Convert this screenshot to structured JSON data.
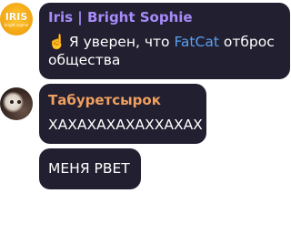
{
  "messages": [
    {
      "sender": "Iris | Bright Sophie",
      "emoji": "☝️",
      "text_before": " Я уверен, что ",
      "link": "FatCat",
      "text_after": " отброс общества",
      "avatar": {
        "icon": "iris-logo-avatar",
        "logo_text": "IRIS",
        "logo_sub": "bright sophie"
      }
    },
    {
      "sender": "Табуретсырок",
      "text": "ХАХАХАХАХАХХАХАХ",
      "avatar": {
        "icon": "cat-photo-avatar"
      }
    },
    {
      "text": "МЕНЯ РВЕТ"
    }
  ],
  "colors": {
    "bubble": "#221f30",
    "name_iris": "#a78bfa",
    "name_tab": "#f0a060",
    "link": "#5aa0f0"
  }
}
